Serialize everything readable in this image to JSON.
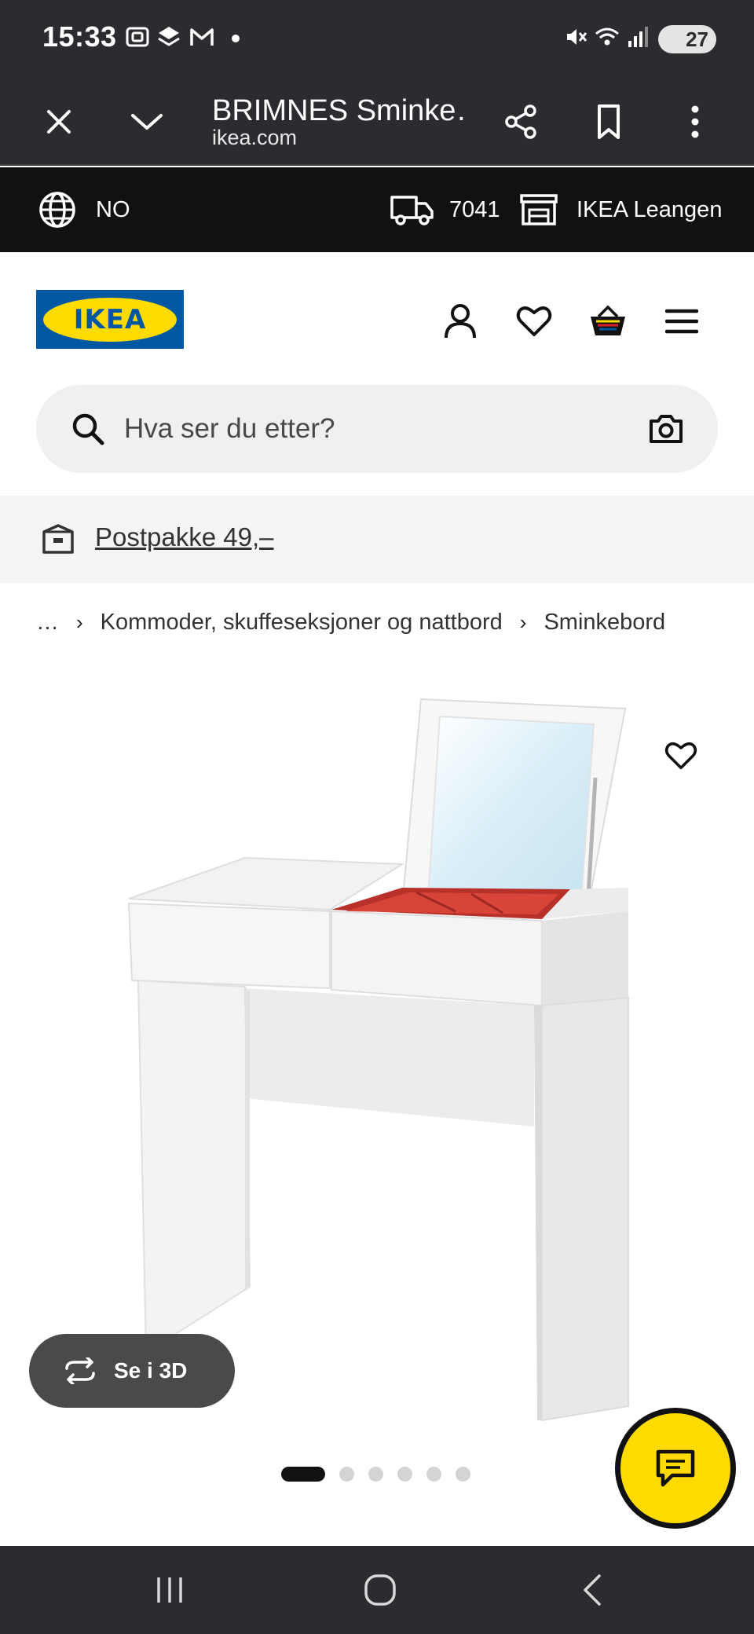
{
  "status_bar": {
    "time": "15:33",
    "battery": "27",
    "icons": [
      "screenshot-icon",
      "app-icon",
      "gmail-icon",
      "dot-icon",
      "mute-icon",
      "wifi-icon",
      "signal-icon",
      "battery-icon"
    ]
  },
  "browser": {
    "title": "BRIMNES Sminke…",
    "domain": "ikea.com",
    "buttons": [
      "close-icon",
      "chevron-down-icon",
      "share-icon",
      "bookmark-icon",
      "more-icon"
    ]
  },
  "info_strip": {
    "language": "NO",
    "postcode": "7041",
    "store": "IKEA Leangen"
  },
  "header": {
    "logo_text": "IKEA",
    "icons": [
      "account-icon",
      "heart-icon",
      "basket-icon",
      "menu-icon"
    ],
    "brand_colors": {
      "blue": "#0058a3",
      "yellow": "#ffdb00"
    }
  },
  "search": {
    "placeholder": "Hva ser du etter?"
  },
  "shipping": {
    "link": "Postpakke 49,–"
  },
  "breadcrumb": {
    "items": [
      "…",
      "Kommoder, skuffeseksjoner og nattbord",
      "Sminkebord"
    ]
  },
  "product_media": {
    "see_3d_label": "Se i 3D",
    "image_count": 6,
    "active_image": 1
  },
  "chat": {
    "icon": "chat-icon",
    "color": "#ffdb00"
  },
  "nav": {
    "buttons": [
      "recents-icon",
      "home-icon",
      "back-icon"
    ]
  }
}
